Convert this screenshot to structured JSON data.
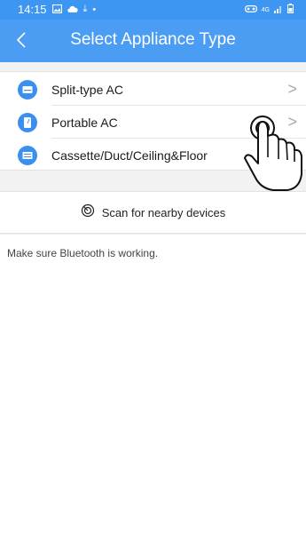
{
  "status_bar": {
    "time": "14:15",
    "download_arrow": "⤓",
    "dot": "•",
    "network": "4G",
    "icons": [
      "gallery-icon",
      "cloud-icon",
      "download-icon",
      "vr-icon",
      "signal-icon",
      "battery-icon"
    ]
  },
  "header": {
    "back_glyph": "<",
    "title": "Select Appliance Type"
  },
  "appliance_list": {
    "items": [
      {
        "label": "Split-type AC",
        "icon": "split-ac-icon"
      },
      {
        "label": "Portable AC",
        "icon": "portable-ac-icon"
      },
      {
        "label": "Cassette/Duct/Ceiling&Floor",
        "icon": "cassette-ac-icon"
      }
    ],
    "chevron": ">"
  },
  "scan": {
    "label": "Scan for nearby devices",
    "icon": "radar-icon"
  },
  "hint": {
    "text": "Make sure Bluetooth is working."
  },
  "colors": {
    "header_blue": "#4a9df3",
    "status_blue": "#3d96f2",
    "icon_blue": "#3b8ff0",
    "background": "#f2f2f2"
  }
}
